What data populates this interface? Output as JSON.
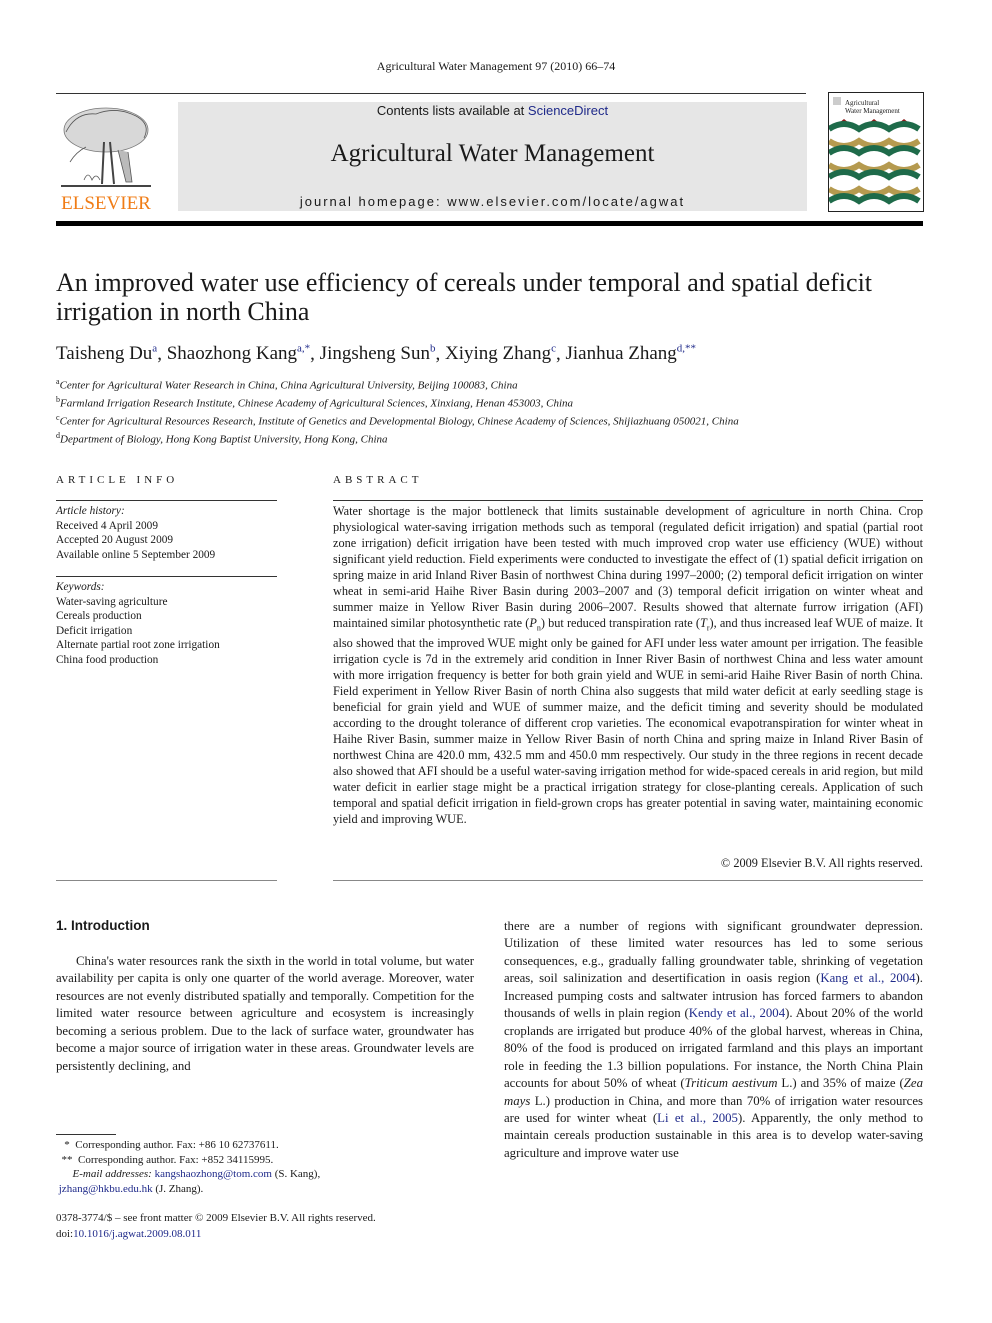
{
  "header": {
    "running_head": "Agricultural Water Management 97 (2010) 66–74",
    "publisher_logo_text": "ELSEVIER",
    "contents_prefix": "Contents lists available at ",
    "contents_link": "ScienceDirect",
    "journal_name": "Agricultural Water Management",
    "homepage_prefix": "journal homepage: ",
    "homepage_url": "www.elsevier.com/locate/agwat",
    "cover_title_line1": "Agricultural",
    "cover_title_line2": "Water Management",
    "colors": {
      "elsevier_orange": "#f07c16",
      "link_blue": "#1f2a8a",
      "masthead_gray": "#e6e6e6",
      "cover_green": "#1e6b4a",
      "cover_gold": "#b59a4f",
      "cover_red": "#8b1a1a"
    }
  },
  "article": {
    "title": "An improved water use efficiency of cereals under temporal and spatial deficit irrigation in north China",
    "authors": [
      {
        "name": "Taisheng Du",
        "sup": "a",
        "sep": ", "
      },
      {
        "name": "Shaozhong Kang",
        "sup": "a,*",
        "sep": ", "
      },
      {
        "name": "Jingsheng Sun",
        "sup": "b",
        "sep": ", "
      },
      {
        "name": "Xiying Zhang",
        "sup": "c",
        "sep": ", "
      },
      {
        "name": "Jianhua Zhang",
        "sup": "d,**",
        "sep": ""
      }
    ],
    "affiliations": [
      {
        "mark": "a",
        "text": "Center for Agricultural Water Research in China, China Agricultural University, Beijing 100083, China"
      },
      {
        "mark": "b",
        "text": "Farmland Irrigation Research Institute, Chinese Academy of Agricultural Sciences, Xinxiang, Henan 453003, China"
      },
      {
        "mark": "c",
        "text": "Center for Agricultural Resources Research, Institute of Genetics and Developmental Biology, Chinese Academy of Sciences, Shijiazhuang 050021, China"
      },
      {
        "mark": "d",
        "text": "Department of Biology, Hong Kong Baptist University, Hong Kong, China"
      }
    ]
  },
  "article_info": {
    "label": "ARTICLE INFO",
    "history_label": "Article history:",
    "history": [
      "Received 4 April 2009",
      "Accepted 20 August 2009",
      "Available online 5 September 2009"
    ],
    "keywords_label": "Keywords:",
    "keywords": [
      "Water-saving agriculture",
      "Cereals production",
      "Deficit irrigation",
      "Alternate partial root zone irrigation",
      "China food production"
    ]
  },
  "abstract": {
    "label": "ABSTRACT",
    "part1": "Water shortage is the major bottleneck that limits sustainable development of agriculture in north China. Crop physiological water-saving irrigation methods such as temporal (regulated deficit irrigation) and spatial (partial root zone irrigation) deficit irrigation have been tested with much improved crop water use efficiency (WUE) without significant yield reduction. Field experiments were conducted to investigate the effect of (1) spatial deficit irrigation on spring maize in arid Inland River Basin of northwest China during 1997–2000; (2) temporal deficit irrigation on winter wheat in semi-arid Haihe River Basin during 2003–2007 and (3) temporal deficit irrigation on winter wheat and summer maize in Yellow River Basin during 2006–2007. Results showed that alternate furrow irrigation (AFI) maintained similar photosynthetic rate (",
    "pn_symbol": "P",
    "pn_sub": "n",
    "part2": ") but reduced transpiration rate (",
    "tr_symbol": "T",
    "tr_sub": "r",
    "part3": "), and thus increased leaf WUE of maize. It also showed that the improved WUE might only be gained for AFI under less water amount per irrigation. The feasible irrigation cycle is 7d in the extremely arid condition in Inner River Basin of northwest China and less water amount with more irrigation frequency is better for both grain yield and WUE in semi-arid Haihe River Basin of north China. Field experiment in Yellow River Basin of north China also suggests that mild water deficit at early seedling stage is beneficial for grain yield and WUE of summer maize, and the deficit timing and severity should be modulated according to the drought tolerance of different crop varieties. The economical evapotranspiration for winter wheat in Haihe River Basin, summer maize in Yellow River Basin of north China and spring maize in Inland River Basin of northwest China are 420.0 mm, 432.5 mm and 450.0 mm respectively. Our study in the three regions in recent decade also showed that AFI should be a useful water-saving irrigation method for wide-spaced cereals in arid region, but mild water deficit in earlier stage might be a practical irrigation strategy for close-planting cereals. Application of such temporal and spatial deficit irrigation in field-grown crops has greater potential in saving water, maintaining economic yield and improving WUE.",
    "copyright": "© 2009 Elsevier B.V. All rights reserved."
  },
  "introduction": {
    "heading": "1.  Introduction",
    "col1": "China's water resources rank the sixth in the world in total volume, but water availability per capita is only one quarter of the world average. Moreover, water resources are not evenly distributed spatially and temporally. Competition for the limited water resource between agriculture and ecosystem is increasingly becoming a serious problem. Due to the lack of surface water, groundwater has become a major source of irrigation water in these areas. Groundwater levels are persistently declining, and",
    "col2_p1": "there are a number of regions with significant groundwater depression. Utilization of these limited water resources has led to some serious consequences, e.g., gradually falling groundwater table, shrinking of vegetation areas, soil salinization and desertification in oasis region (",
    "cite1": "Kang et al., 2004",
    "col2_p2": "). Increased pumping costs and saltwater intrusion has forced farmers to abandon thousands of wells in plain region (",
    "cite2": "Kendy et al., 2004",
    "col2_p3": "). About 20% of the world croplands are irrigated but produce 40% of the global harvest, whereas in China, 80% of the food is produced on irrigated farmland and this plays an important role in feeding the 1.3 billion populations. For instance, the North China Plain accounts for about 50% of wheat (",
    "species1": "Triticum aestivum",
    "col2_p4": " L.) and 35% of maize (",
    "species2": "Zea mays",
    "col2_p5": " L.) production in China, and more than 70% of irrigation water resources are used for winter wheat (",
    "cite3": "Li et al., 2005",
    "col2_p6": "). Apparently, the only method to maintain cereals production sustainable in this area is to develop water-saving agriculture and improve water use"
  },
  "footnotes": {
    "fn1_mark": "*",
    "fn1": "Corresponding author. Fax: +86 10 62737611.",
    "fn2_mark": "**",
    "fn2": "Corresponding author. Fax: +852 34115995.",
    "email_label": "E-mail addresses:",
    "email1": "kangshaozhong@tom.com",
    "email1_owner": " (S. Kang),",
    "email2": "jzhang@hkbu.edu.hk",
    "email2_owner": " (J. Zhang).",
    "front_matter": "0378-3774/$ – see front matter © 2009 Elsevier B.V. All rights reserved.",
    "doi_prefix": "doi:",
    "doi": "10.1016/j.agwat.2009.08.011"
  }
}
